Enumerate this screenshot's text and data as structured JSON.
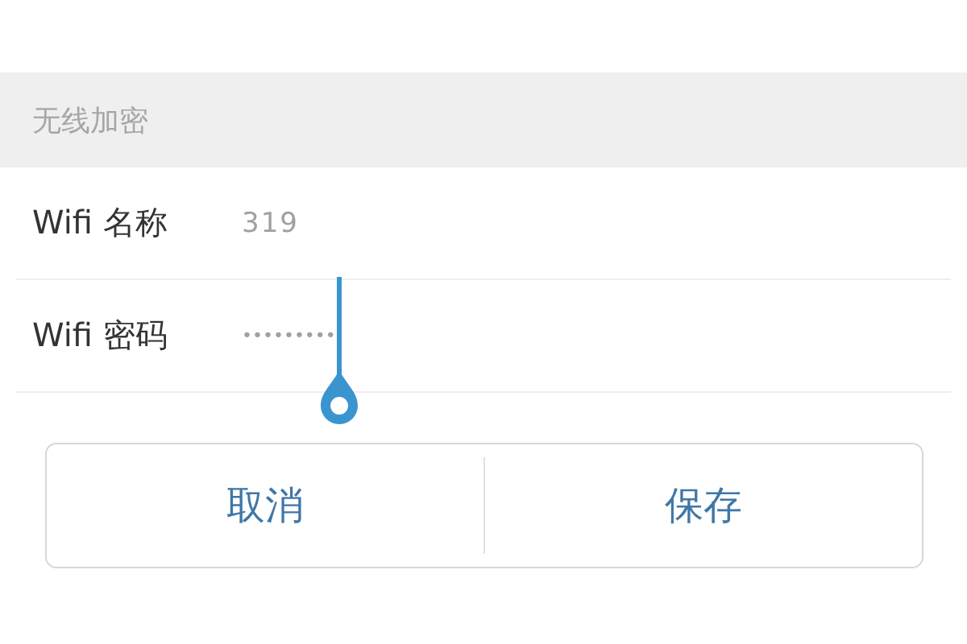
{
  "section": {
    "title": "无线加密"
  },
  "fields": [
    {
      "label": "Wifi 名称",
      "value": "319",
      "focused": false
    },
    {
      "label": "Wifi 密码",
      "value": "•••••••••",
      "focused": true
    }
  ],
  "buttons": [
    "取消",
    "保存"
  ]
}
